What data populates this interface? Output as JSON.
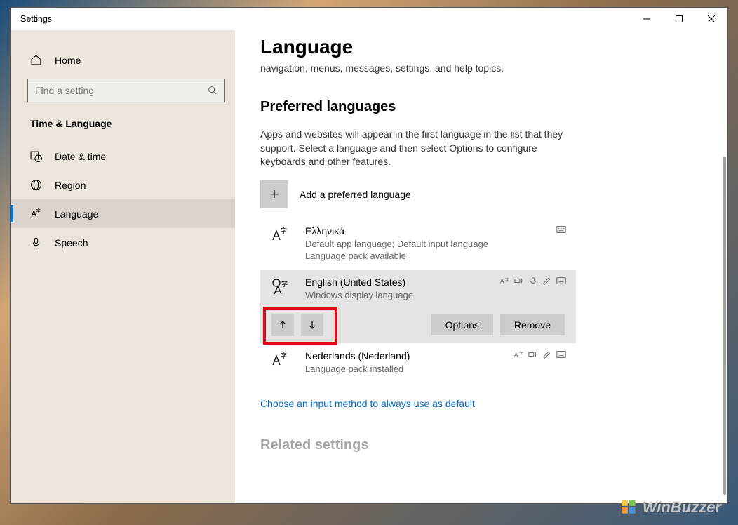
{
  "window": {
    "title": "Settings"
  },
  "sidebar": {
    "home_label": "Home",
    "search_placeholder": "Find a setting",
    "category": "Time & Language",
    "items": [
      {
        "label": "Date & time"
      },
      {
        "label": "Region"
      },
      {
        "label": "Language"
      },
      {
        "label": "Speech"
      }
    ]
  },
  "main": {
    "title": "Language",
    "truncated_intro": "navigation, menus, messages, settings, and help topics.",
    "section_title": "Preferred languages",
    "section_desc": "Apps and websites will appear in the first language in the list that they support. Select a language and then select Options to configure keyboards and other features.",
    "add_language_label": "Add a preferred language",
    "languages": [
      {
        "name": "Ελληνικά",
        "sub": "Default app language; Default input language\nLanguage pack available",
        "icons": [
          "keyboard"
        ]
      },
      {
        "name": "English (United States)",
        "sub": "Windows display language",
        "icons": [
          "az",
          "tts",
          "speech",
          "hand",
          "keyboard"
        ],
        "selected": true
      },
      {
        "name": "Nederlands (Nederland)",
        "sub": "Language pack installed",
        "icons": [
          "az",
          "tts",
          "hand",
          "keyboard"
        ]
      }
    ],
    "options_label": "Options",
    "remove_label": "Remove",
    "input_method_link": "Choose an input method to always use as default",
    "related_title": "Related settings"
  },
  "watermark": "WinBuzzer"
}
